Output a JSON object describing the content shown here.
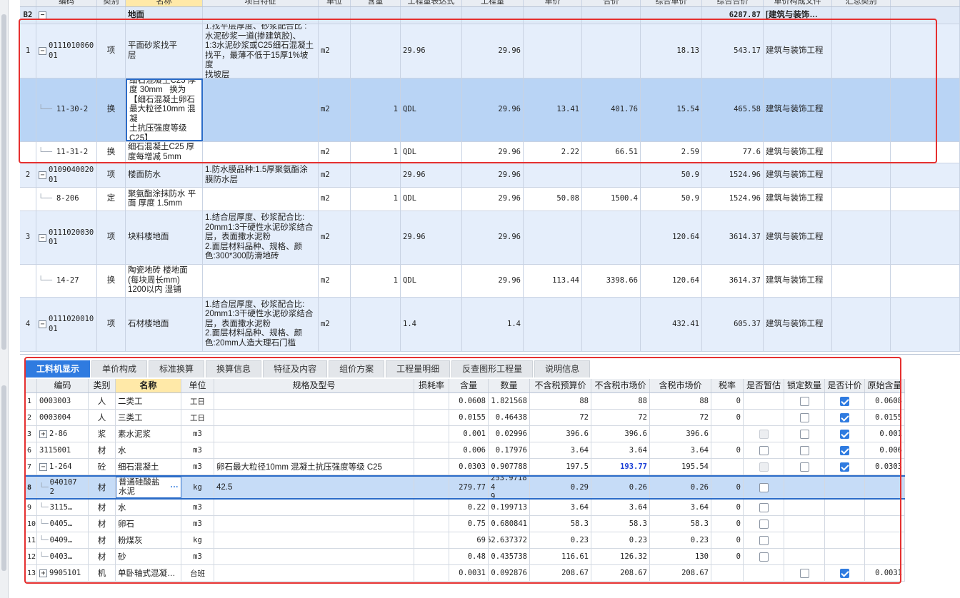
{
  "upper": {
    "headers": [
      "",
      "编码",
      "类别",
      "名称",
      "项目特征",
      "单位",
      "含量",
      "工程量表达式",
      "工程量",
      "单价",
      "合价",
      "综合单价",
      "综合合价",
      "单价构成文件",
      "汇总类别"
    ],
    "group_row": {
      "num": "B2",
      "toggle": "−",
      "name": "地面",
      "total": "6287.87",
      "file": "[建筑与装饰…"
    },
    "rows": [
      {
        "type": "item",
        "num": "1",
        "toggle": "−",
        "code": "011101006001",
        "cat": "项",
        "name": "平面砂浆找平\n层",
        "feature": "1.找平层厚度、砂浆配合比 :\n水泥砂浆一道(掺建筑胶)、\n1:3水泥砂浆或C25细石混凝土\n找平，最薄不低于15厚1%坡度\n找坡层",
        "unit": "m2",
        "content": "",
        "expr": "29.96",
        "qty": "29.96",
        "price": "",
        "amount": "",
        "uprice": "18.13",
        "uamount": "543.17",
        "file": "建筑与装饰工程"
      },
      {
        "type": "sel",
        "num": "",
        "toggle": "",
        "code": "11-30-2",
        "cat": "换",
        "name": "细石混凝土C25 厚\n度 30mm   换为\n【细石混凝土卵石\n最大粒径10mm 混凝\n土抗压强度等级\nC25】",
        "feature": "",
        "unit": "m2",
        "content": "1",
        "expr": "QDL",
        "qty": "29.96",
        "price": "13.41",
        "amount": "401.76",
        "uprice": "15.54",
        "uamount": "465.58",
        "file": "建筑与装饰工程"
      },
      {
        "type": "sub",
        "num": "",
        "toggle": "",
        "code": "11-31-2",
        "cat": "换",
        "name": "细石混凝土C25 厚\n度每增减 5mm",
        "feature": "",
        "unit": "m2",
        "content": "1",
        "expr": "QDL",
        "qty": "29.96",
        "price": "2.22",
        "amount": "66.51",
        "uprice": "2.59",
        "uamount": "77.6",
        "file": "建筑与装饰工程"
      },
      {
        "type": "item",
        "num": "2",
        "toggle": "−",
        "code": "010904002001",
        "cat": "项",
        "name": "楼面防水",
        "feature": "1.防水膜品种:1.5厚聚氨酯涂\n膜防水层",
        "unit": "m2",
        "content": "",
        "expr": "29.96",
        "qty": "29.96",
        "price": "",
        "amount": "",
        "uprice": "50.9",
        "uamount": "1524.96",
        "file": "建筑与装饰工程"
      },
      {
        "type": "sub",
        "num": "",
        "toggle": "",
        "code": "8-206",
        "cat": "定",
        "name": "聚氨酯涂抹防水 平\n面 厚度 1.5mm",
        "feature": "",
        "unit": "m2",
        "content": "1",
        "expr": "QDL",
        "qty": "29.96",
        "price": "50.08",
        "amount": "1500.4",
        "uprice": "50.9",
        "uamount": "1524.96",
        "file": "建筑与装饰工程"
      },
      {
        "type": "item",
        "num": "3",
        "toggle": "−",
        "code": "011102003001",
        "cat": "项",
        "name": "块料楼地面",
        "feature": "1.结合层厚度、砂浆配合比:\n20mm1:3干硬性水泥砂浆结合\n层，表面撒水泥粉\n2.面层材料品种、规格、颜\n色:300*300防滑地砖",
        "unit": "m2",
        "content": "",
        "expr": "29.96",
        "qty": "29.96",
        "price": "",
        "amount": "",
        "uprice": "120.64",
        "uamount": "3614.37",
        "file": "建筑与装饰工程"
      },
      {
        "type": "sub",
        "num": "",
        "toggle": "",
        "code": "14-27",
        "cat": "换",
        "name": "陶瓷地砖 楼地面\n(每块周长mm)\n1200以内 湿铺",
        "feature": "",
        "unit": "m2",
        "content": "1",
        "expr": "QDL",
        "qty": "29.96",
        "price": "113.44",
        "amount": "3398.66",
        "uprice": "120.64",
        "uamount": "3614.37",
        "file": "建筑与装饰工程"
      },
      {
        "type": "item",
        "num": "4",
        "toggle": "−",
        "code": "011102001001",
        "cat": "项",
        "name": "石材楼地面",
        "feature": "1.结合层厚度、砂浆配合比:\n20mm1:3干硬性水泥砂浆结合\n层，表面撒水泥粉\n2.面层材料品种、规格、颜\n色:20mm人造大理石门槛",
        "unit": "m2",
        "content": "",
        "expr": "1.4",
        "qty": "1.4",
        "price": "",
        "amount": "",
        "uprice": "432.41",
        "uamount": "605.37",
        "file": "建筑与装饰工程"
      }
    ]
  },
  "lower": {
    "tabs": [
      "工料机显示",
      "单价构成",
      "标准换算",
      "换算信息",
      "特征及内容",
      "组价方案",
      "工程量明细",
      "反查图形工程量",
      "说明信息"
    ],
    "headers": [
      "",
      "编码",
      "类别",
      "名称",
      "单位",
      "规格及型号",
      "损耗率",
      "含量",
      "数量",
      "不含税预算价",
      "不含税市场价",
      "含税市场价",
      "税率",
      "是否暂估",
      "锁定数量",
      "是否计价",
      "原始含量"
    ],
    "rows": [
      {
        "num": "1",
        "code": "0003003",
        "cat": "人",
        "name": "二类工",
        "unit": "工日",
        "spec": "",
        "loss": "",
        "content": "0.0608",
        "qty": "1.821568",
        "budget": "88",
        "market": "88",
        "taxmarket": "88",
        "tax": "0",
        "est": "",
        "lock": "off",
        "priced": "on",
        "orig": "0.0608"
      },
      {
        "num": "2",
        "code": "0003004",
        "cat": "人",
        "name": "三类工",
        "unit": "工日",
        "spec": "",
        "loss": "",
        "content": "0.0155",
        "qty": "0.46438",
        "budget": "72",
        "market": "72",
        "taxmarket": "72",
        "tax": "0",
        "est": "",
        "lock": "off",
        "priced": "on",
        "orig": "0.0155"
      },
      {
        "num": "3",
        "code": "2-86",
        "toggle": "+",
        "cat": "浆",
        "name": "素水泥浆",
        "unit": "m3",
        "spec": "",
        "loss": "",
        "content": "0.001",
        "qty": "0.02996",
        "budget": "396.6",
        "market": "396.6",
        "taxmarket": "396.6",
        "tax": "",
        "est": "dis",
        "lock": "off",
        "priced": "on",
        "orig": "0.001"
      },
      {
        "num": "6",
        "code": "3115001",
        "cat": "材",
        "name": "水",
        "unit": "m3",
        "spec": "",
        "loss": "",
        "content": "0.006",
        "qty": "0.17976",
        "budget": "3.64",
        "market": "3.64",
        "taxmarket": "3.64",
        "tax": "0",
        "est": "off",
        "lock": "off",
        "priced": "on",
        "orig": "0.006"
      },
      {
        "num": "7",
        "code": "1-264",
        "toggle": "−",
        "cat": "砼",
        "name": "细石混凝土",
        "unit": "m3",
        "spec": "卵石最大粒径10mm 混凝土抗压强度等级 C25",
        "loss": "",
        "content": "0.0303",
        "qty": "0.907788",
        "budget": "197.5",
        "market": "193.77",
        "market_bold": true,
        "taxmarket": "195.54",
        "tax": "",
        "est": "dis",
        "lock": "off",
        "priced": "on",
        "orig": "0.0303"
      },
      {
        "num": "8",
        "sel": true,
        "code": "040107\n2",
        "cat": "材",
        "name": "普通硅酸盐\n水泥",
        "name_btn": "···",
        "unit": "kg",
        "spec": "42.5",
        "loss": "",
        "content": "279.77",
        "qty": "253.97184\n9",
        "budget": "0.29",
        "market": "0.26",
        "taxmarket": "0.26",
        "tax": "0",
        "est": "off",
        "lock": "",
        "priced": "",
        "orig": ""
      },
      {
        "num": "9",
        "code": "3115…",
        "cat": "材",
        "name": "水",
        "unit": "m3",
        "spec": "",
        "loss": "",
        "content": "0.22",
        "qty": "0.199713",
        "budget": "3.64",
        "market": "3.64",
        "taxmarket": "3.64",
        "tax": "0",
        "est": "off",
        "lock": "",
        "priced": "",
        "orig": ""
      },
      {
        "num": "10",
        "code": "0405…",
        "cat": "材",
        "name": "卵石",
        "unit": "m3",
        "spec": "",
        "loss": "",
        "content": "0.75",
        "qty": "0.680841",
        "budget": "58.3",
        "market": "58.3",
        "taxmarket": "58.3",
        "tax": "0",
        "est": "off",
        "lock": "",
        "priced": "",
        "orig": ""
      },
      {
        "num": "11",
        "code": "0409…",
        "cat": "材",
        "name": "粉煤灰",
        "unit": "kg",
        "spec": "",
        "loss": "",
        "content": "69",
        "qty": "62.637372",
        "budget": "0.23",
        "market": "0.23",
        "taxmarket": "0.23",
        "tax": "0",
        "est": "off",
        "lock": "",
        "priced": "",
        "orig": ""
      },
      {
        "num": "12",
        "code": "0403…",
        "cat": "材",
        "name": "砂",
        "unit": "m3",
        "spec": "",
        "loss": "",
        "content": "0.48",
        "qty": "0.435738",
        "budget": "116.61",
        "market": "126.32",
        "taxmarket": "130",
        "tax": "0",
        "est": "off",
        "lock": "",
        "priced": "",
        "orig": ""
      },
      {
        "num": "13",
        "code": "9905101",
        "toggle": "+",
        "cat": "机",
        "name": "单卧轴式混凝…",
        "unit": "台班",
        "spec": "",
        "loss": "",
        "content": "0.0031",
        "qty": "0.092876",
        "budget": "208.67",
        "market": "208.67",
        "taxmarket": "208.67",
        "tax": "",
        "est": "",
        "lock": "off",
        "priced": "on",
        "orig": "0.0031"
      }
    ]
  },
  "colors": {
    "accent": "#2f7be0",
    "selection": "#b9d4f5",
    "annotation": "#e53030"
  }
}
